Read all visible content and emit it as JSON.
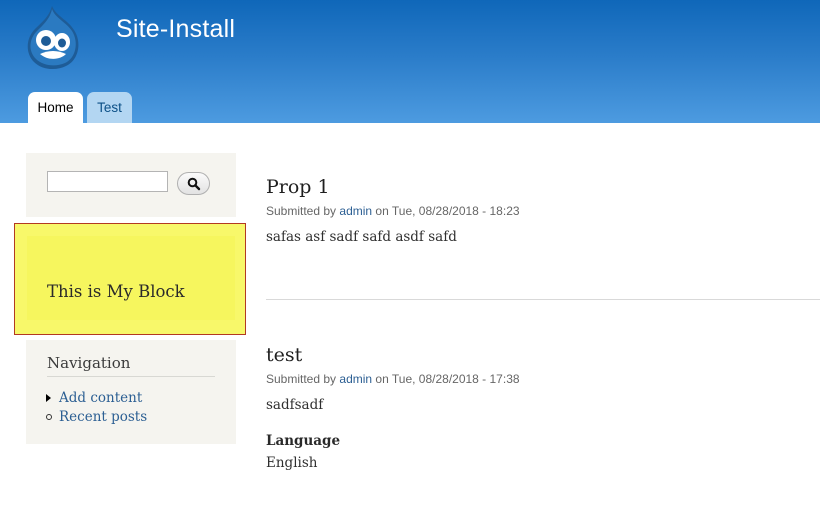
{
  "site": {
    "name": "Site-Install",
    "logo_icon": "drupal-drop-icon"
  },
  "tabs": [
    {
      "label": "Home",
      "active": true
    },
    {
      "label": "Test",
      "active": false
    }
  ],
  "search": {
    "value": "",
    "button_icon": "magnifier-icon"
  },
  "my_block": {
    "text": "This is My Block",
    "highlight_color": "#f8f86a",
    "border_color": "#b23a22"
  },
  "navigation": {
    "title": "Navigation",
    "items": [
      {
        "label": "Add content",
        "bullet": "triangle"
      },
      {
        "label": "Recent posts",
        "bullet": "circle"
      }
    ]
  },
  "nodes": [
    {
      "title": "Prop 1",
      "submitted_prefix": "Submitted by",
      "author": "admin",
      "submitted_suffix": "on Tue, 08/28/2018 - 18:23",
      "body": "safas asf sadf safd asdf safd"
    },
    {
      "title": "test",
      "submitted_prefix": "Submitted by",
      "author": "admin",
      "submitted_suffix": "on Tue, 08/28/2018 - 17:38",
      "body": "sadfsadf",
      "field_label": "Language",
      "field_value": "English"
    }
  ],
  "colors": {
    "header_top": "#0f67b9",
    "header_bottom": "#4d9be0",
    "link": "#2c5f93"
  }
}
